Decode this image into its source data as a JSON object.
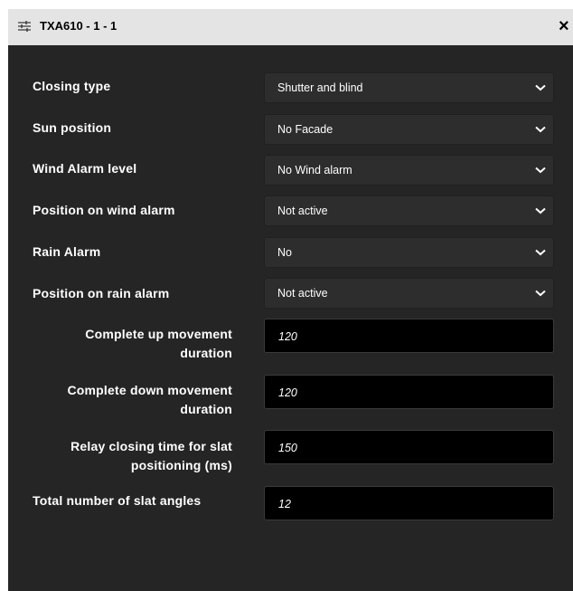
{
  "dialog": {
    "title": "TXA610 - 1 - 1",
    "close_glyph": "×",
    "title_icon": "sliders-icon",
    "close_icon": "close-icon"
  },
  "fields": {
    "closing_type": {
      "label": "Closing type",
      "value": "Shutter and blind"
    },
    "sun_position": {
      "label": "Sun position",
      "value": "No Facade"
    },
    "wind_alarm_level": {
      "label": "Wind Alarm level",
      "value": "No Wind alarm"
    },
    "position_on_wind_alarm": {
      "label": "Position on wind alarm",
      "value": "Not active"
    },
    "rain_alarm": {
      "label": "Rain Alarm",
      "value": "No"
    },
    "position_on_rain_alarm": {
      "label": "Position on rain alarm",
      "value": "Not active"
    },
    "complete_up": {
      "label_line1": "Complete up movement",
      "label_line2": "duration",
      "value": "120"
    },
    "complete_down": {
      "label_line1": "Complete down movement",
      "label_line2": "duration",
      "value": "120"
    },
    "relay_closing_time": {
      "label_line1": "Relay closing time for slat",
      "label_line2": "positioning (ms)",
      "value": "150"
    },
    "total_slat_angles": {
      "label": "Total number of slat angles",
      "value": "12"
    }
  },
  "colors": {
    "panel_background": "#252525",
    "titlebar_background": "#e4e4e4",
    "select_background": "#2d2d2d",
    "input_background": "#000000",
    "text": "#ffffff"
  }
}
